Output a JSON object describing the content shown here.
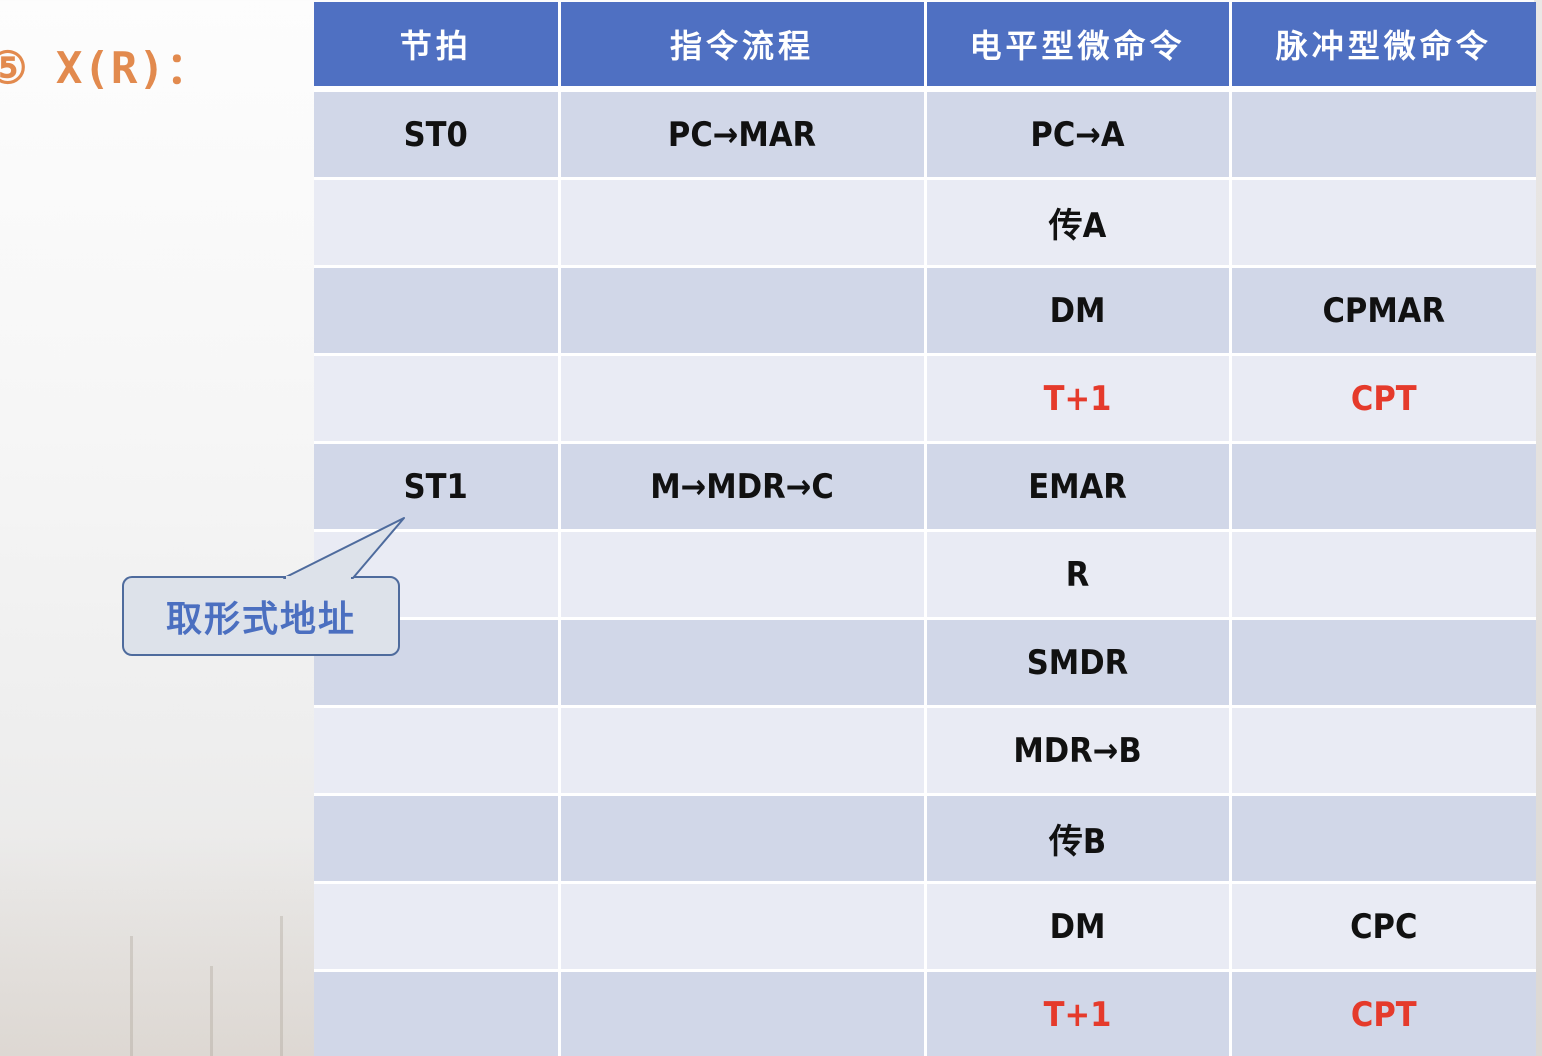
{
  "title": "⑤ X(R)：",
  "table": {
    "headers": [
      "节拍",
      "指令流程",
      "电平型微命令",
      "脉冲型微命令"
    ],
    "rows": [
      {
        "beat": "ST0",
        "flow": "PC→MAR",
        "level": "PC→A",
        "pulse": "",
        "red": false
      },
      {
        "beat": "",
        "flow": "",
        "level": "传A",
        "pulse": "",
        "red": false
      },
      {
        "beat": "",
        "flow": "",
        "level": "DM",
        "pulse": "CPMAR",
        "red": false
      },
      {
        "beat": "",
        "flow": "",
        "level": "T+1",
        "pulse": "CPT",
        "red": true
      },
      {
        "beat": "ST1",
        "flow": "M→MDR→C",
        "level": "EMAR",
        "pulse": "",
        "red": false
      },
      {
        "beat": "",
        "flow": "",
        "level": "R",
        "pulse": "",
        "red": false
      },
      {
        "beat": "",
        "flow": "",
        "level": "SMDR",
        "pulse": "",
        "red": false
      },
      {
        "beat": "",
        "flow": "",
        "level": "MDR→B",
        "pulse": "",
        "red": false
      },
      {
        "beat": "",
        "flow": "",
        "level": "传B",
        "pulse": "",
        "red": false
      },
      {
        "beat": "",
        "flow": "",
        "level": "DM",
        "pulse": "CPC",
        "red": false
      },
      {
        "beat": "",
        "flow": "",
        "level": "T+1",
        "pulse": "CPT",
        "red": true
      }
    ]
  },
  "callout": {
    "text": "取形式地址"
  },
  "colors": {
    "header_bg": "#4f70c2",
    "row_dark": "#d1d7e8",
    "row_light": "#e9ebf4",
    "title": "#e28a4e",
    "red_text": "#e53a2b",
    "callout_text": "#4b6fc0",
    "callout_border": "#4e6b9d"
  }
}
